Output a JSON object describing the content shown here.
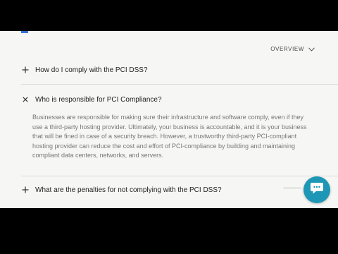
{
  "header": {
    "overview_label": "OVERVIEW"
  },
  "faq": {
    "items": [
      {
        "question": "How do I comply with the PCI DSS?",
        "expanded": false,
        "icon": "plus-icon"
      },
      {
        "question": "Who is responsible for PCI Compliance?",
        "expanded": true,
        "icon": "close-icon",
        "answer": "Businesses are responsible for making sure their infrastructure and software comply, even if they use a third-party hosting provider. Ultimately, your business is accountable, and it is your business that will be fined in case of a security breach. However, a trustworthy third-party PCI-compliant hosting provider can reduce the cost and effort of PCI-compliance by building and maintaining compliant data centers, networks, and servers."
      },
      {
        "question": "What are the penalties for not complying with the PCI DSS?",
        "expanded": false,
        "icon": "plus-icon"
      }
    ]
  },
  "chat": {
    "icon": "chat-bubble-icon",
    "color": "#1e97b6"
  }
}
